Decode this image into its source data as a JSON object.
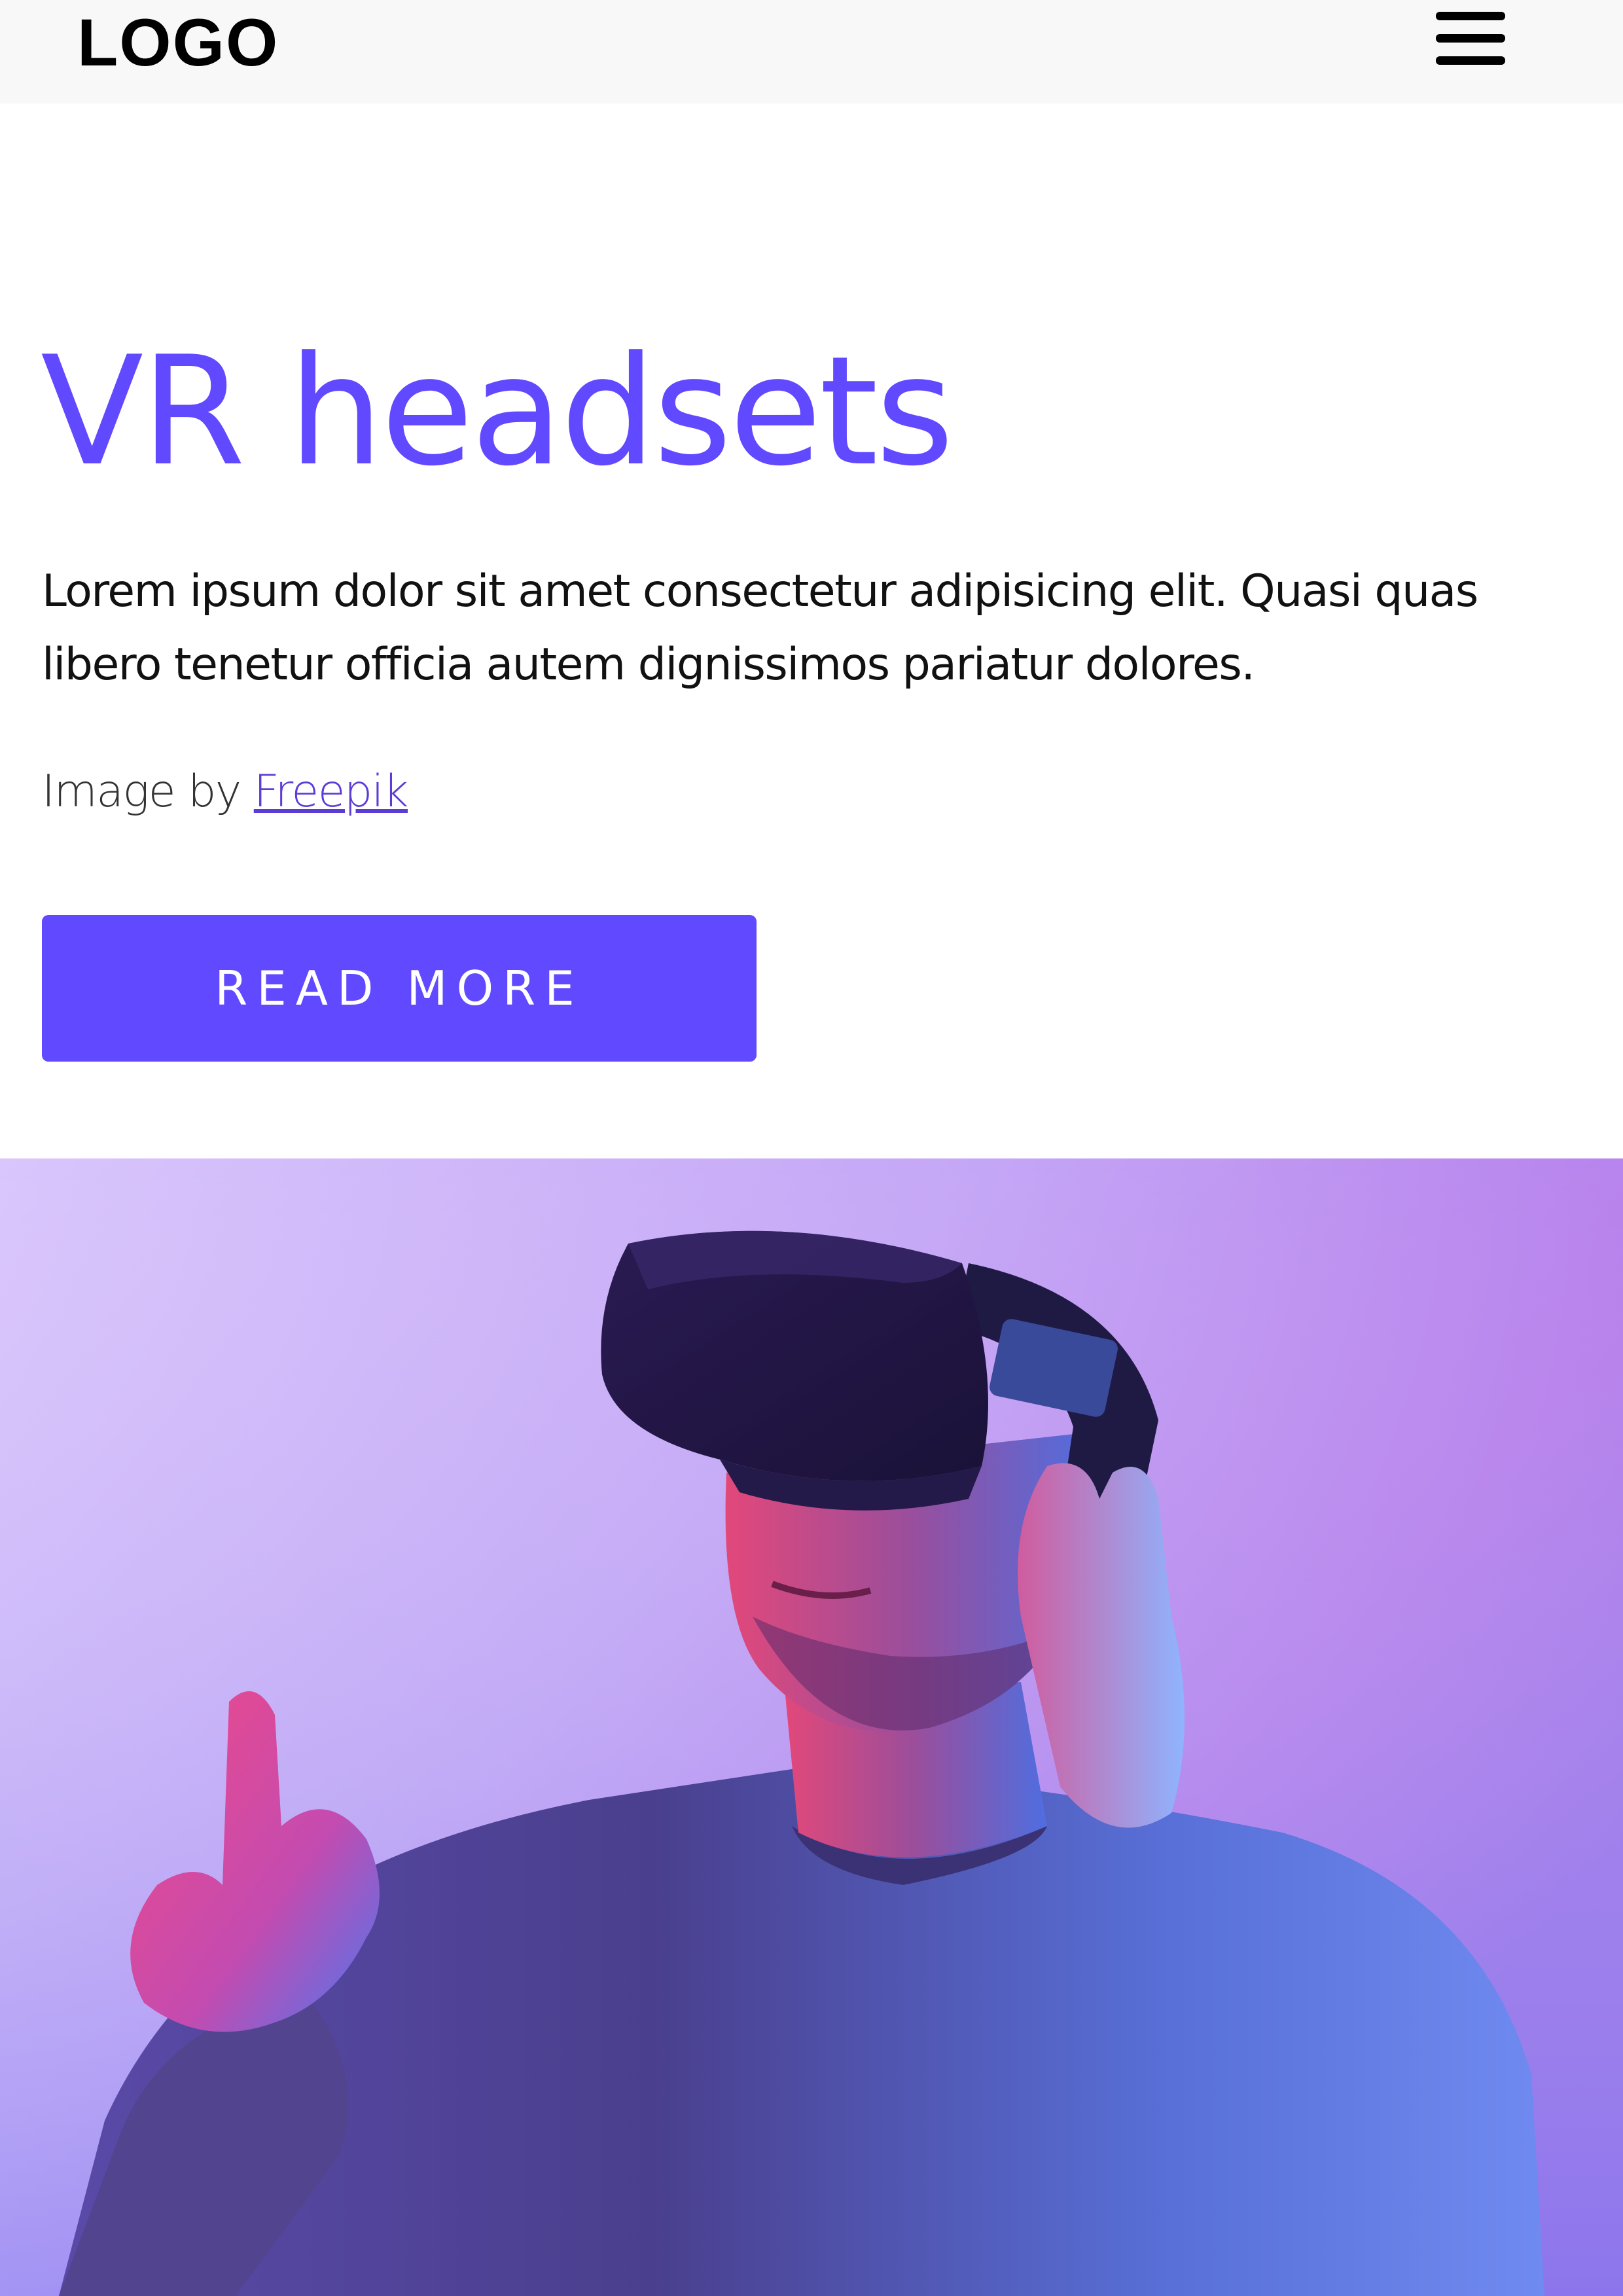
{
  "header": {
    "logo_text": "LOGO",
    "menu_icon": "hamburger-menu-icon"
  },
  "hero": {
    "title": "VR headsets",
    "description": "Lorem ipsum dolor sit amet consectetur adipisicing elit. Quasi quas libero tenetur officia autem dignissimos pariatur dolores.",
    "credit_prefix": "Image by ",
    "credit_link": "Freepik",
    "button_label": "READ MORE",
    "image_subject": "man wearing VR headset pointing"
  },
  "colors": {
    "accent": "#6149ff",
    "header_bg": "#f8f8f8",
    "link": "#5c3bd6",
    "image_bg_light": "#d8c3fb",
    "image_bg_pink": "#b778e8",
    "image_bg_blue": "#6f74ec"
  }
}
